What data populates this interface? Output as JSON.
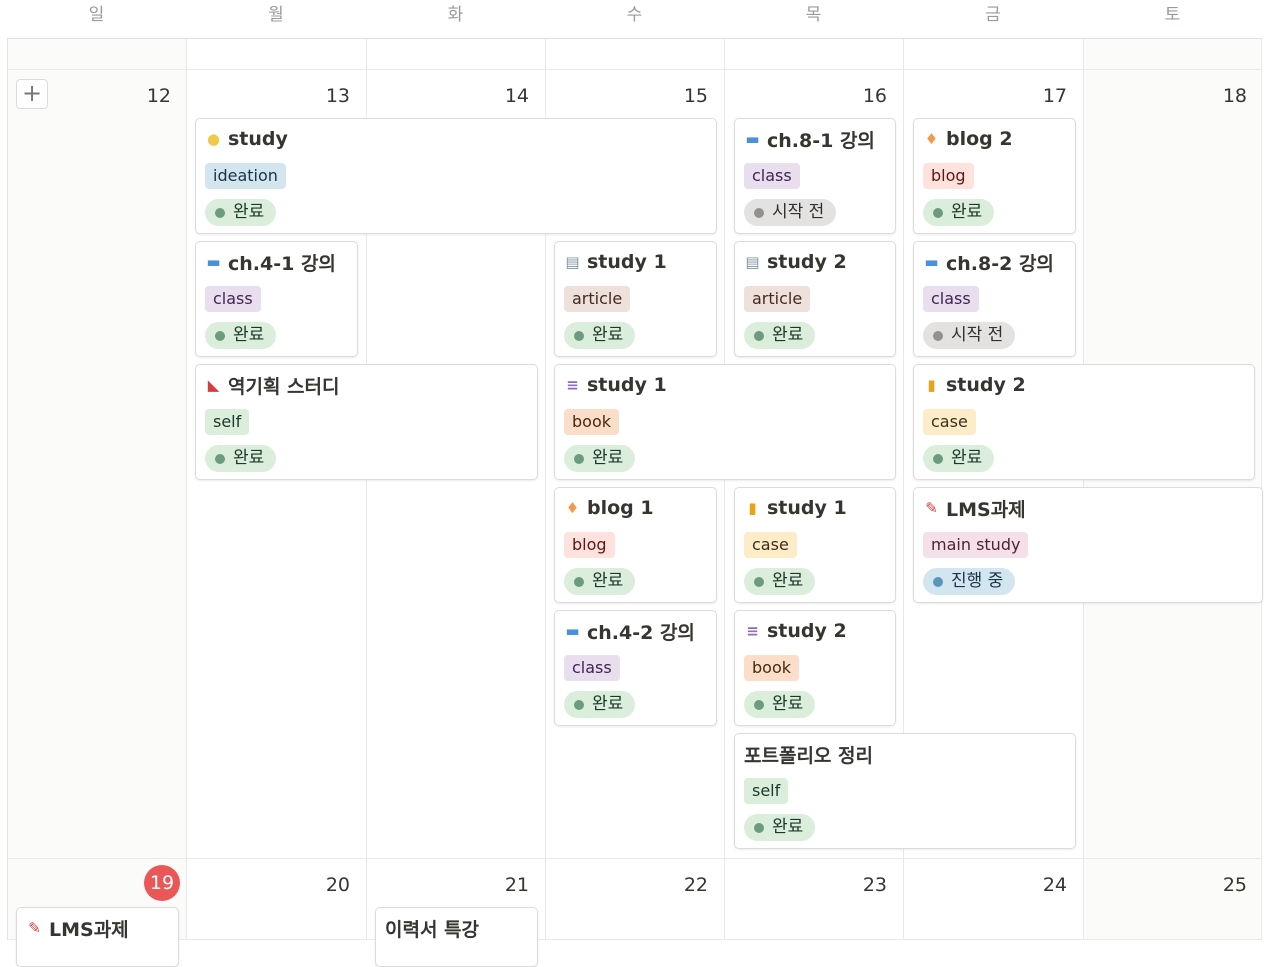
{
  "weekdays": [
    "일",
    "월",
    "화",
    "수",
    "목",
    "금",
    "토"
  ],
  "week1_days": [
    "12",
    "13",
    "14",
    "15",
    "16",
    "17",
    "18"
  ],
  "week2_days": [
    "19",
    "20",
    "21",
    "22",
    "23",
    "24",
    "25"
  ],
  "today": "19",
  "add_button": "+",
  "events": {
    "study_idea": {
      "title": "study",
      "icon": "bulb-icon",
      "tag": "ideation",
      "status": "완료"
    },
    "ch81": {
      "title": "ch.8-1 강의",
      "icon": "laptop-icon",
      "tag": "class",
      "status": "시작 전"
    },
    "blog2": {
      "title": "blog 2",
      "icon": "candle-icon",
      "tag": "blog",
      "status": "완료"
    },
    "ch41": {
      "title": "ch.4-1 강의",
      "icon": "laptop-icon",
      "tag": "class",
      "status": "완료"
    },
    "study1_article": {
      "title": "study 1",
      "icon": "newspaper-icon",
      "tag": "article",
      "status": "완료"
    },
    "study2_article": {
      "title": "study 2",
      "icon": "newspaper-icon",
      "tag": "article",
      "status": "완료"
    },
    "ch82": {
      "title": "ch.8-2 강의",
      "icon": "laptop-icon",
      "tag": "class",
      "status": "시작 전"
    },
    "reverse_plan": {
      "title": "역기획 스터디",
      "icon": "sneaker-icon",
      "tag": "self",
      "status": "완료"
    },
    "study1_book": {
      "title": "study 1",
      "icon": "books-icon",
      "tag": "book",
      "status": "완료"
    },
    "study2_case": {
      "title": "study 2",
      "icon": "notebook-icon",
      "tag": "case",
      "status": "완료"
    },
    "blog1": {
      "title": "blog 1",
      "icon": "candle-icon",
      "tag": "blog",
      "status": "완료"
    },
    "study1_case": {
      "title": "study 1",
      "icon": "notebook-icon",
      "tag": "case",
      "status": "완료"
    },
    "lms": {
      "title": "LMS과제",
      "icon": "pencil-icon",
      "tag": "main study",
      "status": "진행 중"
    },
    "ch42": {
      "title": "ch.4-2 강의",
      "icon": "laptop-icon",
      "tag": "class",
      "status": "완료"
    },
    "study2_book": {
      "title": "study 2",
      "icon": "books-icon",
      "tag": "book",
      "status": "완료"
    },
    "portfolio": {
      "title": "포트폴리오 정리",
      "tag": "self",
      "status": "완료"
    },
    "lms_w2": {
      "title": "LMS과제",
      "icon": "pencil-icon"
    },
    "resume": {
      "title": "이력서 특강"
    }
  },
  "colors": {
    "accent_today": "#eb5757",
    "tag_ideation": "#d3e5ef",
    "tag_class": "#e8deee",
    "tag_blog": "#ffe2dd",
    "tag_article": "#eee0da",
    "tag_self": "#dbeddb",
    "tag_book": "#fadec9",
    "tag_case": "#fdecc8",
    "tag_main_study": "#f5e0e9",
    "status_done": "#dbeddb",
    "status_todo": "#e3e2e0",
    "status_progress": "#d3e5ef"
  }
}
